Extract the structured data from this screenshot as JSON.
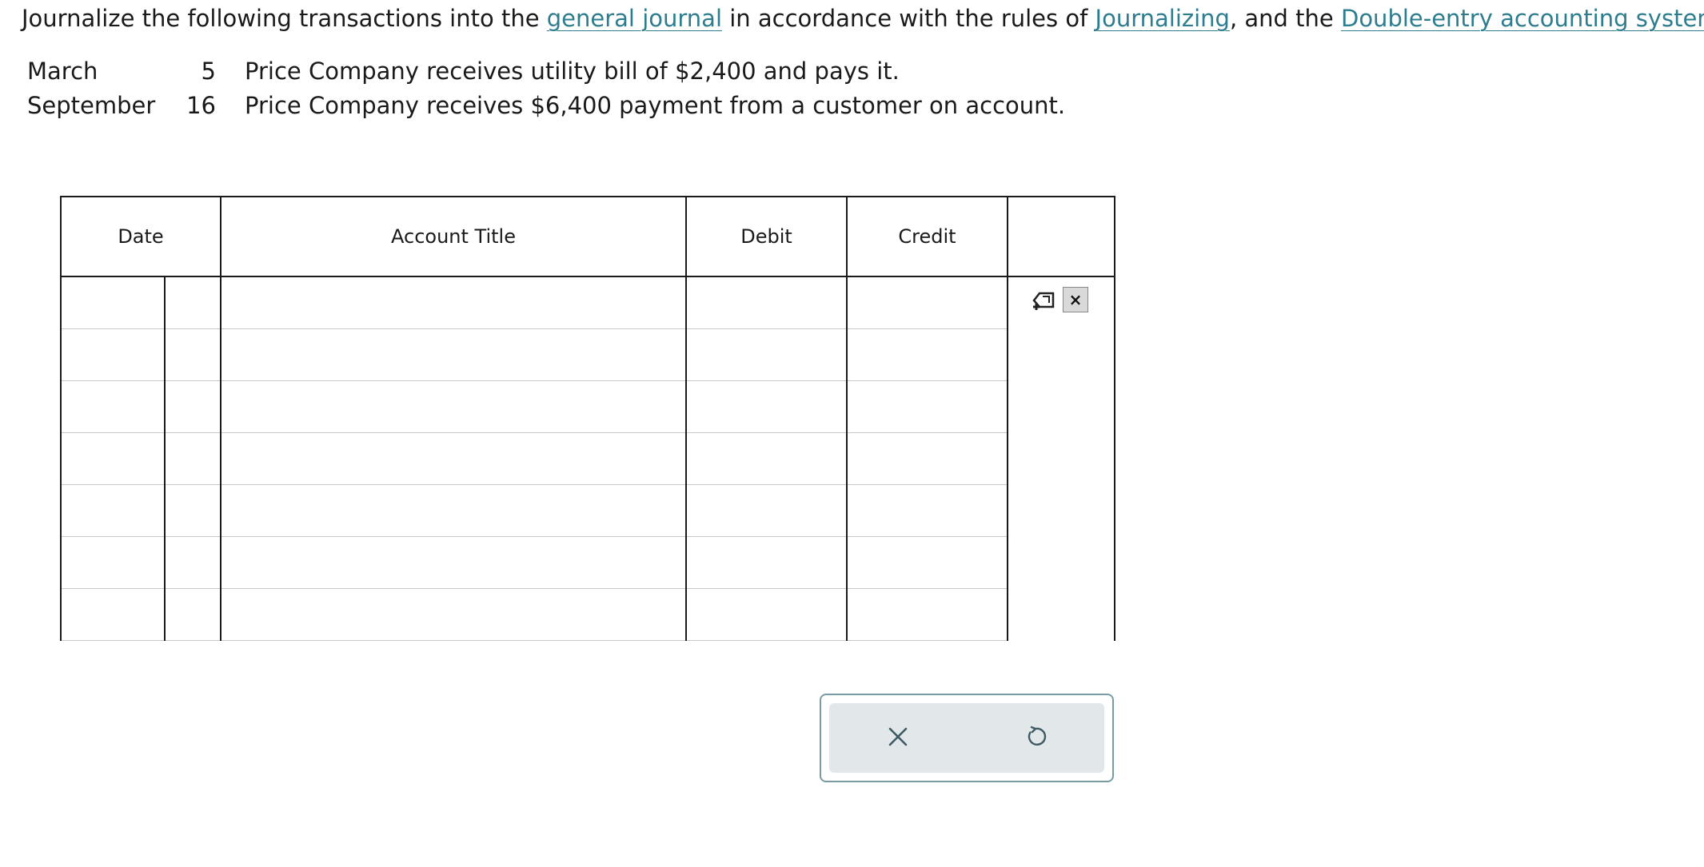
{
  "instructions": {
    "part1": "Journalize the following transactions into the ",
    "link1": "general journal",
    "part2": " in accordance with the rules of ",
    "link2": "Journalizing",
    "part3": ", and the ",
    "link3": "Double-entry accounting system",
    "part4": ".",
    "link_color": "#2e7d8f"
  },
  "transactions": [
    {
      "month": "March",
      "day": "5",
      "description": "Price Company receives utility bill of $2,400 and pays it."
    },
    {
      "month": "September",
      "day": "16",
      "description": "Price Company receives $6,400 payment from a customer on account."
    }
  ],
  "journal": {
    "headers": {
      "date": "Date",
      "account_title": "Account Title",
      "debit": "Debit",
      "credit": "Credit",
      "controls": ""
    },
    "rows": [
      {
        "month": "",
        "day": "",
        "account": "",
        "debit": "",
        "credit": ""
      },
      {
        "month": "",
        "day": "",
        "account": "",
        "debit": "",
        "credit": ""
      },
      {
        "month": "",
        "day": "",
        "account": "",
        "debit": "",
        "credit": ""
      },
      {
        "month": "",
        "day": "",
        "account": "",
        "debit": "",
        "credit": ""
      },
      {
        "month": "",
        "day": "",
        "account": "",
        "debit": "",
        "credit": ""
      },
      {
        "month": "",
        "day": "",
        "account": "",
        "debit": "",
        "credit": ""
      },
      {
        "month": "",
        "day": "",
        "account": "",
        "debit": "",
        "credit": ""
      }
    ],
    "row_tools": {
      "add_icon": "add-row-icon",
      "delete_label": "×"
    }
  },
  "actions": {
    "clear_icon": "close-icon",
    "reset_icon": "undo-icon",
    "icon_color": "#3d5a63",
    "panel_color": "#e2e8ea",
    "border_color": "#7a9aa3"
  }
}
